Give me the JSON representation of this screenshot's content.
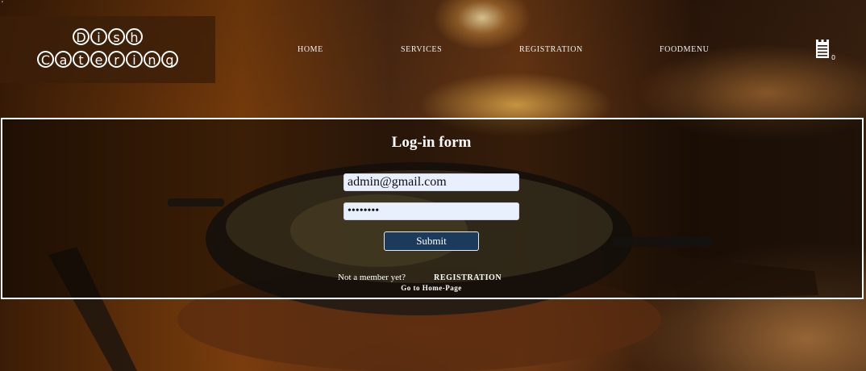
{
  "corner_mark": "'",
  "logo": {
    "line1": [
      "D",
      "i",
      "s",
      "h"
    ],
    "line2": [
      "C",
      "a",
      "t",
      "e",
      "r",
      "i",
      "n",
      "g"
    ]
  },
  "nav": {
    "items": [
      {
        "label": "HOME"
      },
      {
        "label": "SERVICES"
      },
      {
        "label": "REGISTRATION"
      },
      {
        "label": "FOODMENU"
      }
    ]
  },
  "cart": {
    "icon": "cart-list-icon",
    "count": "0"
  },
  "login": {
    "title": "Log-in form",
    "email_value": "admin@gmail.com",
    "password_value": "••••••••",
    "submit_label": "Submit",
    "member_prompt": "Not a member yet?",
    "registration_link": "REGISTRATION",
    "home_link": "Go to Home-Page"
  },
  "colors": {
    "panel_border": "#ffffff",
    "button_bg": "#1c3a5c",
    "input_bg": "#e8f0fe"
  }
}
